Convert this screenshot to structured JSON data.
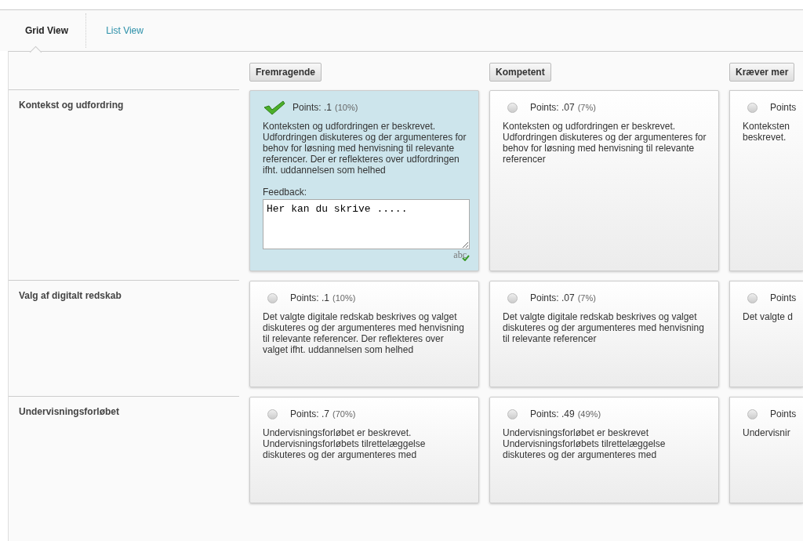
{
  "tabs": [
    {
      "label": "Grid View",
      "selected": true
    },
    {
      "label": "List View",
      "selected": false
    }
  ],
  "levels": [
    {
      "label": "Fremragende"
    },
    {
      "label": "Kompetent"
    },
    {
      "label": "Kræver mer"
    }
  ],
  "criteria": [
    {
      "name": "Kontekst og udfordring",
      "cells": [
        {
          "selected": true,
          "points": "Points: .1",
          "percent": "(10%)",
          "description": "Konteksten og udfordringen er beskrevet. Udfordringen diskuteres og der argumenteres for behov for løsning med henvisning til relevante referencer. Der er reflekteres over udfordringen ifht. uddannelsen som helhed",
          "feedback": {
            "label": "Feedback:",
            "value": "Her kan du skrive .....",
            "spellcheck": "abc"
          }
        },
        {
          "selected": false,
          "points": "Points: .07",
          "percent": "(7%)",
          "description": "Konteksten og udfordringen er beskrevet. Udfordringen diskuteres og der argumenteres for behov for løsning med henvisning til relevante referencer"
        },
        {
          "selected": false,
          "points": "Points",
          "description": "Konteksten beskrevet."
        }
      ]
    },
    {
      "name": "Valg af digitalt redskab",
      "cells": [
        {
          "selected": false,
          "points": "Points: .1",
          "percent": "(10%)",
          "description": "Det valgte digitale redskab beskrives og valget diskuteres og der argumenteres med henvisning til relevante referencer. Der reflekteres over valget ifht. uddannelsen som helhed"
        },
        {
          "selected": false,
          "points": "Points: .07",
          "percent": "(7%)",
          "description": "Det valgte digitale redskab beskrives og valget diskuteres og der argumenteres med henvisning til relevante referencer"
        },
        {
          "selected": false,
          "points": "Points",
          "description": "Det valgte d"
        }
      ]
    },
    {
      "name": "Undervisningsforløbet",
      "cells": [
        {
          "selected": false,
          "points": "Points: .7",
          "percent": "(70%)",
          "description": "Undervisningsforløbet er beskrevet. Undervisningsforløbets tilrettelæggelse diskuteres og der argumenteres med"
        },
        {
          "selected": false,
          "points": "Points: .49",
          "percent": "(49%)",
          "description": "Undervisningsforløbet er beskrevet Undervisningsforløbets tilrettelæggelse diskuteres og der argumenteres med"
        },
        {
          "selected": false,
          "points": "Points",
          "description": "Undervisnir"
        }
      ]
    }
  ]
}
